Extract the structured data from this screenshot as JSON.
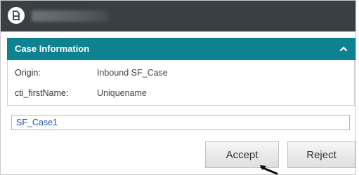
{
  "titlebar": {
    "logo_icon": "app-logo-icon",
    "color": "#3a3f44"
  },
  "section": {
    "title": "Case Information",
    "collapse_icon": "chevron-up-icon",
    "color": "#0f8291"
  },
  "fields": [
    {
      "label": "Origin:",
      "value": "Inbound SF_Case"
    },
    {
      "label": "cti_firstName:",
      "value": "Uniquename"
    }
  ],
  "case_input": {
    "value": "SF_Case1"
  },
  "buttons": {
    "accept_label": "Accept",
    "reject_label": "Reject"
  },
  "cursor_icon": "mouse-pointer-icon"
}
